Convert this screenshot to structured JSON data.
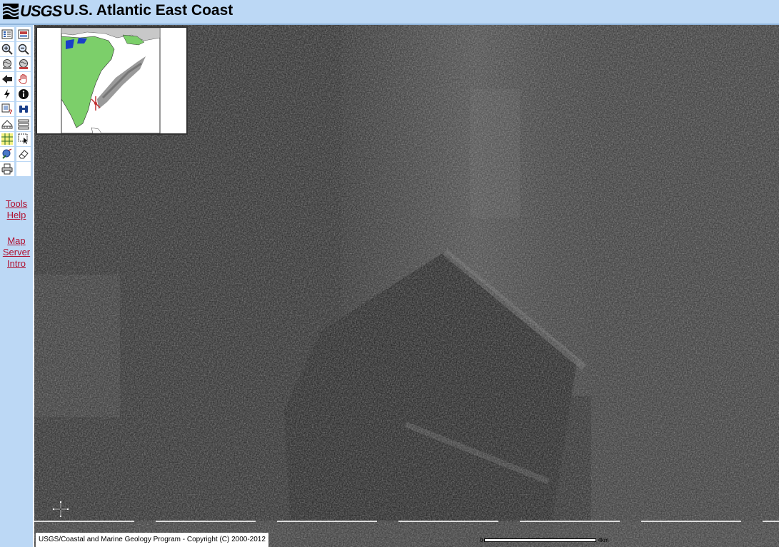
{
  "header": {
    "logo_text": "USGS",
    "title": "U.S. Atlantic East Coast",
    "bg_color": "#bcd8f5"
  },
  "toolbar": {
    "tools": [
      {
        "name": "toggle-legend-button",
        "icon": "legend-icon"
      },
      {
        "name": "toggle-layers-button",
        "icon": "layers-icon"
      },
      {
        "name": "zoom-in-button",
        "icon": "zoom-in-icon"
      },
      {
        "name": "zoom-out-button",
        "icon": "zoom-out-icon"
      },
      {
        "name": "zoom-full-button",
        "icon": "globe-icon"
      },
      {
        "name": "zoom-active-button",
        "icon": "globe-layer-icon"
      },
      {
        "name": "zoom-previous-button",
        "icon": "back-arrow-icon"
      },
      {
        "name": "pan-button",
        "icon": "hand-icon"
      },
      {
        "name": "hyperlink-button",
        "icon": "lightning-icon"
      },
      {
        "name": "identify-button",
        "icon": "info-icon"
      },
      {
        "name": "query-button",
        "icon": "query-icon"
      },
      {
        "name": "find-button",
        "icon": "binoculars-icon"
      },
      {
        "name": "measure-button",
        "icon": "measure-icon"
      },
      {
        "name": "set-units-button",
        "icon": "units-icon"
      },
      {
        "name": "select-rectangle-button",
        "icon": "select-grid-icon"
      },
      {
        "name": "select-line-button",
        "icon": "select-line-icon"
      },
      {
        "name": "select-by-shape-button",
        "icon": "select-shape-icon"
      },
      {
        "name": "clear-selection-button",
        "icon": "eraser-icon"
      },
      {
        "name": "print-button",
        "icon": "printer-icon"
      }
    ],
    "help_links": {
      "tools_help_1": "Tools",
      "tools_help_2": "Help",
      "map_intro_1": "Map",
      "map_intro_2": "Server",
      "map_intro_3": "Intro"
    },
    "link_color": "#b01030"
  },
  "map": {
    "copyright": "USGS/Coastal and Marine Geology Program - Copyright (C) 2000-2012",
    "scale_start": "0",
    "scale_end": "4km"
  }
}
